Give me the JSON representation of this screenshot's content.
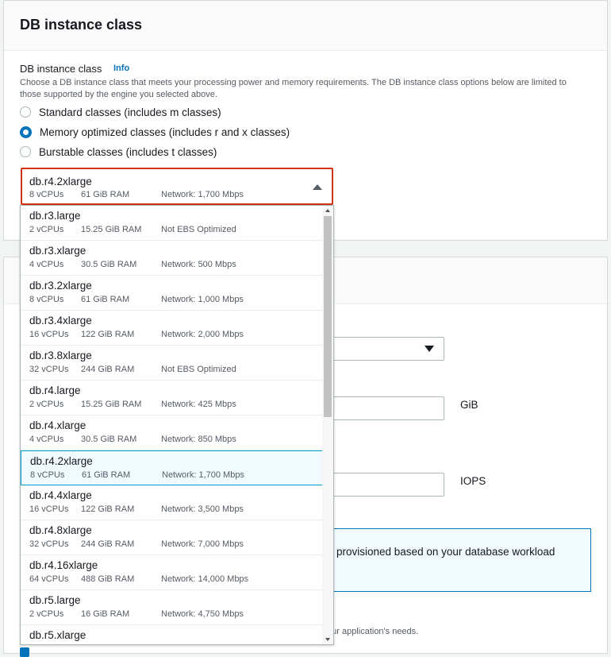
{
  "panel_top": {
    "title": "DB instance class",
    "field_label": "DB instance class",
    "info_link": "Info",
    "description": "Choose a DB instance class that meets your processing power and memory requirements. The DB instance class options below are limited to those supported by the engine you selected above.",
    "radios": [
      {
        "label": "Standard classes (includes m classes)",
        "checked": false
      },
      {
        "label": "Memory optimized classes (includes r and x classes)",
        "checked": true
      },
      {
        "label": "Burstable classes (includes t classes)",
        "checked": false
      }
    ]
  },
  "selected": {
    "name": "db.r4.2xlarge",
    "vcpus": "8 vCPUs",
    "ram": "61 GiB RAM",
    "network": "Network: 1,700 Mbps"
  },
  "options": [
    {
      "name": "db.r3.large",
      "vcpus": "2 vCPUs",
      "ram": "15.25 GiB RAM",
      "network": "Not EBS Optimized"
    },
    {
      "name": "db.r3.xlarge",
      "vcpus": "4 vCPUs",
      "ram": "30.5 GiB RAM",
      "network": "Network: 500 Mbps"
    },
    {
      "name": "db.r3.2xlarge",
      "vcpus": "8 vCPUs",
      "ram": "61 GiB RAM",
      "network": "Network: 1,000 Mbps"
    },
    {
      "name": "db.r3.4xlarge",
      "vcpus": "16 vCPUs",
      "ram": "122 GiB RAM",
      "network": "Network: 2,000 Mbps"
    },
    {
      "name": "db.r3.8xlarge",
      "vcpus": "32 vCPUs",
      "ram": "244 GiB RAM",
      "network": "Not EBS Optimized"
    },
    {
      "name": "db.r4.large",
      "vcpus": "2 vCPUs",
      "ram": "15.25 GiB RAM",
      "network": "Network: 425 Mbps"
    },
    {
      "name": "db.r4.xlarge",
      "vcpus": "4 vCPUs",
      "ram": "30.5 GiB RAM",
      "network": "Network: 850 Mbps"
    },
    {
      "name": "db.r4.2xlarge",
      "vcpus": "8 vCPUs",
      "ram": "61 GiB RAM",
      "network": "Network: 1,700 Mbps",
      "selected": true
    },
    {
      "name": "db.r4.4xlarge",
      "vcpus": "16 vCPUs",
      "ram": "122 GiB RAM",
      "network": "Network: 3,500 Mbps"
    },
    {
      "name": "db.r4.8xlarge",
      "vcpus": "32 vCPUs",
      "ram": "244 GiB RAM",
      "network": "Network: 7,000 Mbps"
    },
    {
      "name": "db.r4.16xlarge",
      "vcpus": "64 vCPUs",
      "ram": "488 GiB RAM",
      "network": "Network: 14,000 Mbps"
    },
    {
      "name": "db.r5.large",
      "vcpus": "2 vCPUs",
      "ram": "16 GiB RAM",
      "network": "Network: 4,750 Mbps"
    },
    {
      "name": "db.r5.xlarge",
      "vcpus": "",
      "ram": "",
      "network": ""
    }
  ],
  "background": {
    "storage_unit": "GiB",
    "iops_unit": "IOPS",
    "info_text": "provisioned based on your database workload",
    "desc_text": "our application's needs."
  },
  "colors": {
    "accent": "#0073bb",
    "error_border": "#d13212",
    "selected_bg": "#f1faff",
    "selected_border": "#00a1c9"
  }
}
